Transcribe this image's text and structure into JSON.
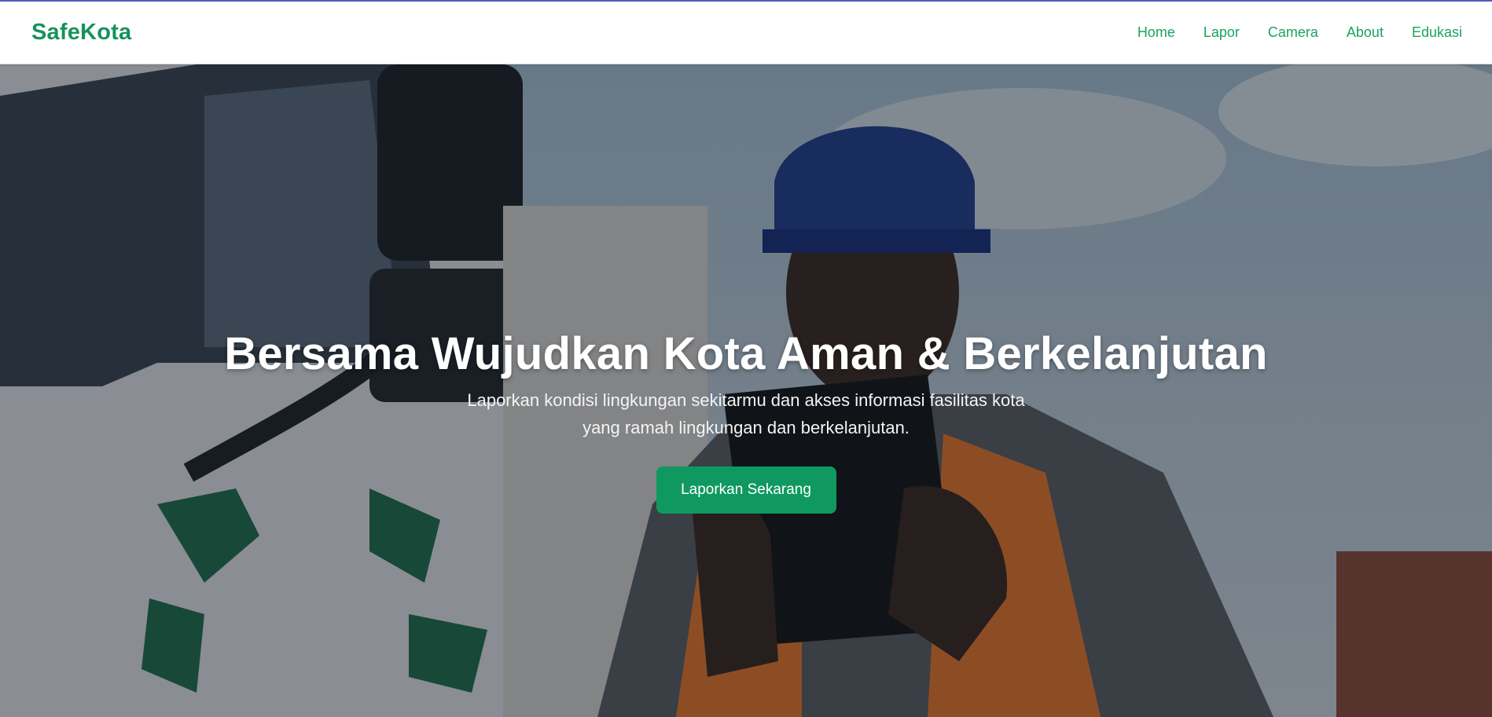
{
  "header": {
    "brand": "SafeKota",
    "nav": [
      "Home",
      "Lapor",
      "Camera",
      "About",
      "Edukasi"
    ]
  },
  "hero": {
    "title": "Bersama Wujudkan Kota Aman & Berkelanjutan",
    "subtitle_line1": "Laporkan kondisi lingkungan sekitarmu dan akses informasi fasilitas kota",
    "subtitle_line2": "yang ramah lingkungan dan berkelanjutan.",
    "cta_label": "Laporkan Sekarang"
  },
  "colors": {
    "brand": "#16925f",
    "nav_link": "#19a35f",
    "cta": "#0f9960"
  }
}
